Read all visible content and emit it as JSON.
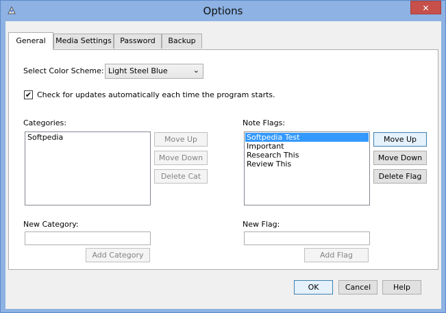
{
  "window": {
    "title": "Options",
    "close_glyph": "✕",
    "app_icon": "paint-palette-icon"
  },
  "tabs": [
    "General",
    "Media Settings",
    "Password",
    "Backup"
  ],
  "general": {
    "color_scheme_label": "Select Color Scheme:",
    "color_scheme_value": "Light Steel Blue",
    "check_updates_label": "Check for updates automatically each time the program starts.",
    "check_updates_checked": true,
    "categories_label": "Categories:",
    "categories": [
      "Softpedia"
    ],
    "cat_move_up": "Move Up",
    "cat_move_down": "Move Down",
    "cat_delete": "Delete Cat",
    "note_flags_label": "Note Flags:",
    "note_flags": [
      "Softpedia Test",
      "Important",
      "Research This",
      "Review This"
    ],
    "flag_move_up": "Move Up",
    "flag_move_down": "Move Down",
    "flag_delete": "Delete Flag",
    "new_category_label": "New Category:",
    "new_category_value": "",
    "add_category": "Add Category",
    "new_flag_label": "New Flag:",
    "new_flag_value": "",
    "add_flag": "Add Flag"
  },
  "footer": {
    "ok": "OK",
    "cancel": "Cancel",
    "help": "Help"
  }
}
